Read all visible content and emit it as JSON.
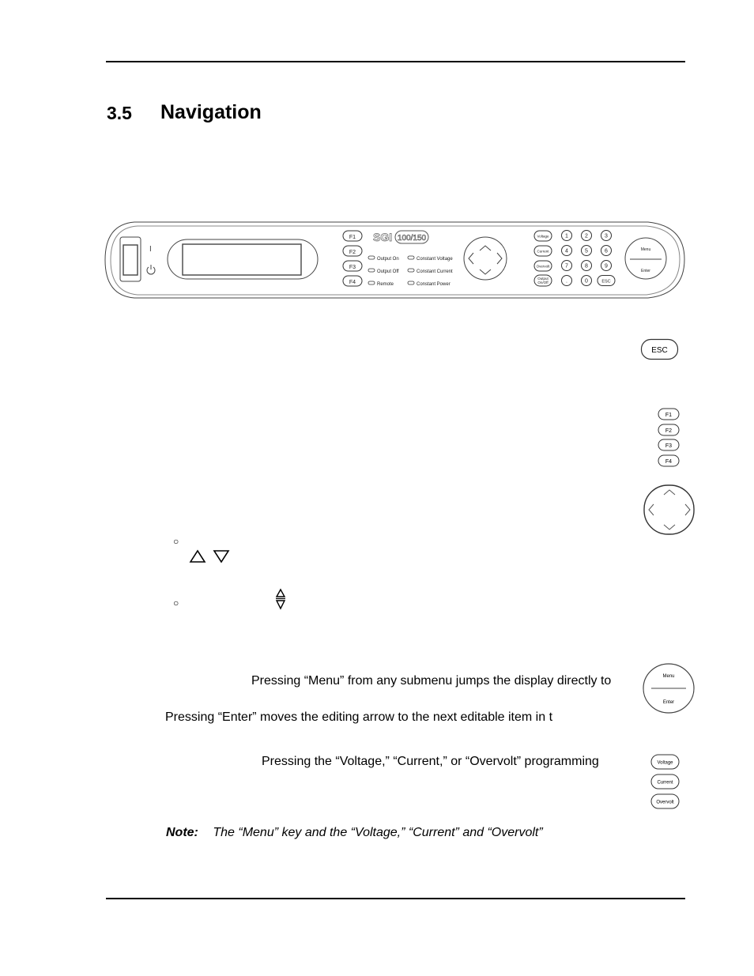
{
  "section": {
    "number": "3.5",
    "title": "Navigation"
  },
  "front_panel": {
    "brand": "SGI",
    "model": "100/150",
    "power_on_symbol": "I",
    "function_keys": [
      "F1",
      "F2",
      "F3",
      "F4"
    ],
    "indicators_left": [
      "Output On",
      "Output Off",
      "Remote"
    ],
    "indicators_right": [
      "Constant Voltage",
      "Constant Current",
      "Constant Power"
    ],
    "program_keys": [
      "Voltage",
      "Current",
      "Overvolt"
    ],
    "output_key": [
      "Output",
      "On/Off"
    ],
    "keypad": [
      "1",
      "2",
      "3",
      "4",
      "5",
      "6",
      "7",
      "8",
      "9",
      ".",
      "0",
      "ESC"
    ],
    "menu_label": "Menu",
    "enter_label": "Enter"
  },
  "side_keys": {
    "esc": "ESC",
    "function_keys": [
      "F1",
      "F2",
      "F3",
      "F4"
    ],
    "menu": "Menu",
    "enter": "Enter",
    "program_keys": [
      "Voltage",
      "Current",
      "Overvolt"
    ]
  },
  "bullets": {
    "up_down_glyphs": "△ ▽",
    "updown_glyph_top": "△",
    "updown_glyph_bottom": "▽"
  },
  "paragraphs": {
    "menu": "Pressing “Menu” from any submenu jumps the display directly to",
    "enter": "Pressing “Enter” moves the editing arrow to the next editable item in t",
    "program": "Pressing the “Voltage,” “Current,” or “Overvolt” programming"
  },
  "note": {
    "label": "Note:",
    "text": "The “Menu” key and the “Voltage,” “Current” and “Overvolt”"
  }
}
